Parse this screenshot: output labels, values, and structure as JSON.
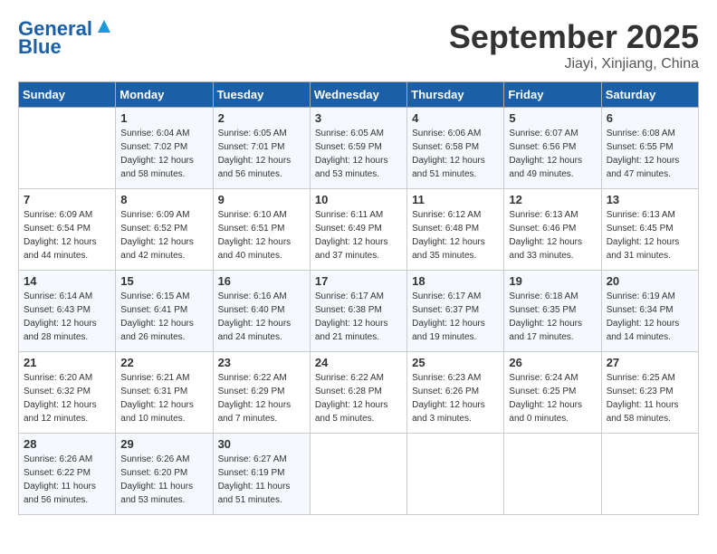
{
  "header": {
    "logo_line1": "General",
    "logo_line2": "Blue",
    "month_year": "September 2025",
    "location": "Jiayi, Xinjiang, China"
  },
  "days_of_week": [
    "Sunday",
    "Monday",
    "Tuesday",
    "Wednesday",
    "Thursday",
    "Friday",
    "Saturday"
  ],
  "weeks": [
    [
      {
        "day": "",
        "sunrise": "",
        "sunset": "",
        "daylight": ""
      },
      {
        "day": "1",
        "sunrise": "Sunrise: 6:04 AM",
        "sunset": "Sunset: 7:02 PM",
        "daylight": "Daylight: 12 hours and 58 minutes."
      },
      {
        "day": "2",
        "sunrise": "Sunrise: 6:05 AM",
        "sunset": "Sunset: 7:01 PM",
        "daylight": "Daylight: 12 hours and 56 minutes."
      },
      {
        "day": "3",
        "sunrise": "Sunrise: 6:05 AM",
        "sunset": "Sunset: 6:59 PM",
        "daylight": "Daylight: 12 hours and 53 minutes."
      },
      {
        "day": "4",
        "sunrise": "Sunrise: 6:06 AM",
        "sunset": "Sunset: 6:58 PM",
        "daylight": "Daylight: 12 hours and 51 minutes."
      },
      {
        "day": "5",
        "sunrise": "Sunrise: 6:07 AM",
        "sunset": "Sunset: 6:56 PM",
        "daylight": "Daylight: 12 hours and 49 minutes."
      },
      {
        "day": "6",
        "sunrise": "Sunrise: 6:08 AM",
        "sunset": "Sunset: 6:55 PM",
        "daylight": "Daylight: 12 hours and 47 minutes."
      }
    ],
    [
      {
        "day": "7",
        "sunrise": "Sunrise: 6:09 AM",
        "sunset": "Sunset: 6:54 PM",
        "daylight": "Daylight: 12 hours and 44 minutes."
      },
      {
        "day": "8",
        "sunrise": "Sunrise: 6:09 AM",
        "sunset": "Sunset: 6:52 PM",
        "daylight": "Daylight: 12 hours and 42 minutes."
      },
      {
        "day": "9",
        "sunrise": "Sunrise: 6:10 AM",
        "sunset": "Sunset: 6:51 PM",
        "daylight": "Daylight: 12 hours and 40 minutes."
      },
      {
        "day": "10",
        "sunrise": "Sunrise: 6:11 AM",
        "sunset": "Sunset: 6:49 PM",
        "daylight": "Daylight: 12 hours and 37 minutes."
      },
      {
        "day": "11",
        "sunrise": "Sunrise: 6:12 AM",
        "sunset": "Sunset: 6:48 PM",
        "daylight": "Daylight: 12 hours and 35 minutes."
      },
      {
        "day": "12",
        "sunrise": "Sunrise: 6:13 AM",
        "sunset": "Sunset: 6:46 PM",
        "daylight": "Daylight: 12 hours and 33 minutes."
      },
      {
        "day": "13",
        "sunrise": "Sunrise: 6:13 AM",
        "sunset": "Sunset: 6:45 PM",
        "daylight": "Daylight: 12 hours and 31 minutes."
      }
    ],
    [
      {
        "day": "14",
        "sunrise": "Sunrise: 6:14 AM",
        "sunset": "Sunset: 6:43 PM",
        "daylight": "Daylight: 12 hours and 28 minutes."
      },
      {
        "day": "15",
        "sunrise": "Sunrise: 6:15 AM",
        "sunset": "Sunset: 6:41 PM",
        "daylight": "Daylight: 12 hours and 26 minutes."
      },
      {
        "day": "16",
        "sunrise": "Sunrise: 6:16 AM",
        "sunset": "Sunset: 6:40 PM",
        "daylight": "Daylight: 12 hours and 24 minutes."
      },
      {
        "day": "17",
        "sunrise": "Sunrise: 6:17 AM",
        "sunset": "Sunset: 6:38 PM",
        "daylight": "Daylight: 12 hours and 21 minutes."
      },
      {
        "day": "18",
        "sunrise": "Sunrise: 6:17 AM",
        "sunset": "Sunset: 6:37 PM",
        "daylight": "Daylight: 12 hours and 19 minutes."
      },
      {
        "day": "19",
        "sunrise": "Sunrise: 6:18 AM",
        "sunset": "Sunset: 6:35 PM",
        "daylight": "Daylight: 12 hours and 17 minutes."
      },
      {
        "day": "20",
        "sunrise": "Sunrise: 6:19 AM",
        "sunset": "Sunset: 6:34 PM",
        "daylight": "Daylight: 12 hours and 14 minutes."
      }
    ],
    [
      {
        "day": "21",
        "sunrise": "Sunrise: 6:20 AM",
        "sunset": "Sunset: 6:32 PM",
        "daylight": "Daylight: 12 hours and 12 minutes."
      },
      {
        "day": "22",
        "sunrise": "Sunrise: 6:21 AM",
        "sunset": "Sunset: 6:31 PM",
        "daylight": "Daylight: 12 hours and 10 minutes."
      },
      {
        "day": "23",
        "sunrise": "Sunrise: 6:22 AM",
        "sunset": "Sunset: 6:29 PM",
        "daylight": "Daylight: 12 hours and 7 minutes."
      },
      {
        "day": "24",
        "sunrise": "Sunrise: 6:22 AM",
        "sunset": "Sunset: 6:28 PM",
        "daylight": "Daylight: 12 hours and 5 minutes."
      },
      {
        "day": "25",
        "sunrise": "Sunrise: 6:23 AM",
        "sunset": "Sunset: 6:26 PM",
        "daylight": "Daylight: 12 hours and 3 minutes."
      },
      {
        "day": "26",
        "sunrise": "Sunrise: 6:24 AM",
        "sunset": "Sunset: 6:25 PM",
        "daylight": "Daylight: 12 hours and 0 minutes."
      },
      {
        "day": "27",
        "sunrise": "Sunrise: 6:25 AM",
        "sunset": "Sunset: 6:23 PM",
        "daylight": "Daylight: 11 hours and 58 minutes."
      }
    ],
    [
      {
        "day": "28",
        "sunrise": "Sunrise: 6:26 AM",
        "sunset": "Sunset: 6:22 PM",
        "daylight": "Daylight: 11 hours and 56 minutes."
      },
      {
        "day": "29",
        "sunrise": "Sunrise: 6:26 AM",
        "sunset": "Sunset: 6:20 PM",
        "daylight": "Daylight: 11 hours and 53 minutes."
      },
      {
        "day": "30",
        "sunrise": "Sunrise: 6:27 AM",
        "sunset": "Sunset: 6:19 PM",
        "daylight": "Daylight: 11 hours and 51 minutes."
      },
      {
        "day": "",
        "sunrise": "",
        "sunset": "",
        "daylight": ""
      },
      {
        "day": "",
        "sunrise": "",
        "sunset": "",
        "daylight": ""
      },
      {
        "day": "",
        "sunrise": "",
        "sunset": "",
        "daylight": ""
      },
      {
        "day": "",
        "sunrise": "",
        "sunset": "",
        "daylight": ""
      }
    ]
  ]
}
